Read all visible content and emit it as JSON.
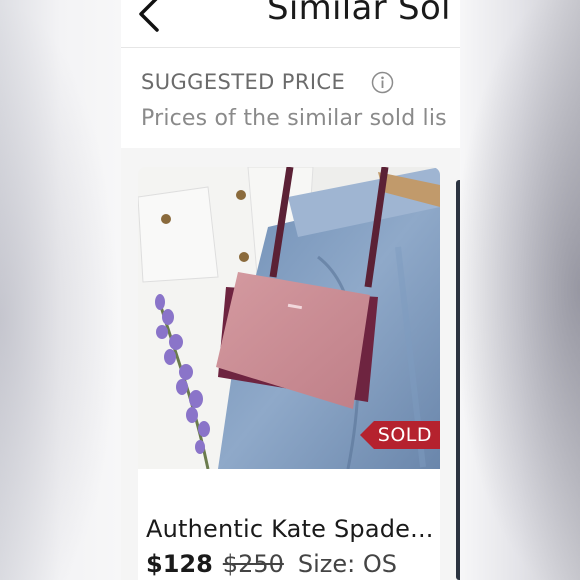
{
  "header": {
    "title": "Similar Sol"
  },
  "suggested": {
    "section_title": "SUGGESTED PRICE",
    "subtitle": "Prices of the similar sold lis"
  },
  "listing": {
    "title": "Authentic Kate Spade...",
    "price": "$128",
    "original_price": "$250",
    "size": "Size: OS",
    "status_badge": "SOLD"
  },
  "colors": {
    "sold_badge": "#b5222e",
    "text_primary": "#1a1a1a",
    "text_secondary": "#6b6b6b"
  },
  "icons": {
    "back": "chevron-left-icon",
    "info": "info-icon"
  }
}
